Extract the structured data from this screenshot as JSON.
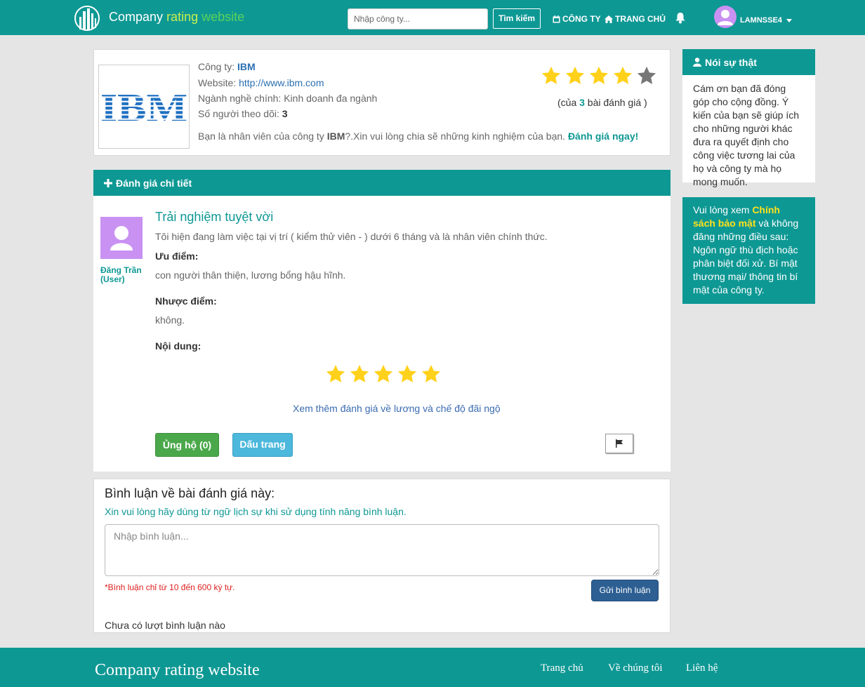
{
  "nav": {
    "brand_part1": "Company",
    "brand_part2": "rating",
    "brand_part3": "website",
    "search_placeholder": "Nhập công ty...",
    "search_button": "Tìm kiếm",
    "link_company": "CÔNG TY",
    "link_home": "TRANG CHỦ",
    "username": "LAMNSSE4"
  },
  "company": {
    "logo_text": "IBM",
    "label_company": "Công ty: ",
    "name": "IBM",
    "label_website": "Website: ",
    "website": "http://www.ibm.com",
    "industry": "Ngành nghề chính: Kinh doanh đa ngành",
    "label_followers": "Số người theo dõi: ",
    "followers": "3",
    "invite_prefix": "Bạn là nhân viên của công ty ",
    "invite_company": "IBM",
    "invite_middle": "?.Xin vui lòng chia sẽ những kinh nghiệm của bạn. ",
    "invite_cta": "Đánh giá ngay!",
    "rating_stars": 4,
    "rating_max": 5,
    "rating_prefix": "(của ",
    "rating_count": "3",
    "rating_suffix": " bài đánh giá )"
  },
  "sidebar": {
    "truth_title": "Nói sự thật",
    "truth_body": "Cám ơn bạn đã đóng góp cho cộng đồng. Ý kiến của bạn sẽ giúp ích cho những người khác đưa ra quyết định cho công việc tương lai của họ và công ty mà họ mong muốn.",
    "policy_prefix": "Vui lòng xem ",
    "policy_link": "Chính sách bảo mật",
    "policy_suffix": " và không đăng những điều sau: Ngôn ngữ thù địch hoặc phân biệt đối xử. Bí mật thương mại/ thông tin bí mật của công ty."
  },
  "review": {
    "section_title": "Đánh giá chi tiết",
    "reviewer_name": "Đăng Trần",
    "reviewer_role": "(User)",
    "title": "Trải nghiệm tuyệt vời",
    "position": "Tôi hiện đang làm việc tại vị trí ( kiểm thử viên - ) dưới 6 tháng và là nhân viên chính thức.",
    "pros_label": "Ưu điểm:",
    "pros": "con người thân thiện, lương bổng hậu hĩnh.",
    "cons_label": "Nhược điểm:",
    "cons": "không.",
    "content_label": "Nội dung:",
    "stars": 5,
    "salary_link": "Xem thêm đánh giá về lương và chế độ đãi ngộ",
    "support_button": "Ủng hộ (0)",
    "bookmark_button": "Dấu trang"
  },
  "comments": {
    "title": "Bình luận về bài đánh giá này:",
    "note": "Xin vui lòng hãy dùng từ ngữ lịch sự khi sử dụng tính năng bình luận.",
    "placeholder": "Nhập bình luận...",
    "warning": "*Bình luận chỉ từ 10 đến 600 ký tự.",
    "send_button": "Gửi bình luận",
    "empty": "Chưa có lượt bình luận nào"
  },
  "footer": {
    "brand": "Company rating website",
    "link_home": "Trang chủ",
    "link_about": "Về chúng tôi",
    "link_contact": "Liên hệ"
  },
  "colors": {
    "primary": "#0e9894",
    "star_on": "#ffd11a",
    "star_off": "#777777",
    "success": "#4aa84a",
    "info": "#4cb8dc",
    "danger": "#e02020"
  }
}
